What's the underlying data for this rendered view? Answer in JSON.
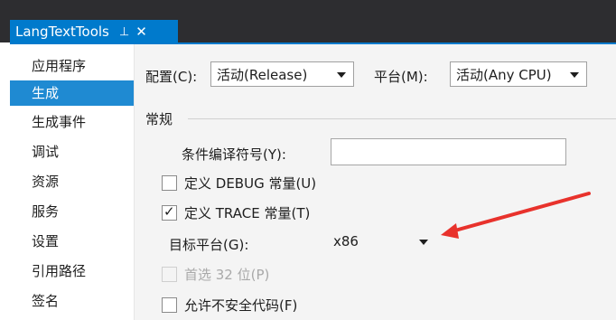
{
  "window": {
    "tab_title": "LangTextTools",
    "pin_icon": "pin-icon",
    "close_icon": "close-icon",
    "accent_color": "#007acc"
  },
  "nav": {
    "items": [
      {
        "label": "应用程序",
        "selected": false
      },
      {
        "label": "生成",
        "selected": true
      },
      {
        "label": "生成事件",
        "selected": false
      },
      {
        "label": "调试",
        "selected": false
      },
      {
        "label": "资源",
        "selected": false
      },
      {
        "label": "服务",
        "selected": false
      },
      {
        "label": "设置",
        "selected": false
      },
      {
        "label": "引用路径",
        "selected": false
      },
      {
        "label": "签名",
        "selected": false
      }
    ]
  },
  "config": {
    "config_label": "配置(C):",
    "config_value": "活动(Release)",
    "platform_label": "平台(M):",
    "platform_value": "活动(Any CPU)"
  },
  "general": {
    "section_title": "常规",
    "symbols_label": "条件编译符号(Y):",
    "symbols_value": "",
    "define_debug_label": "定义 DEBUG 常量(U)",
    "define_debug_checked": false,
    "define_trace_label": "定义 TRACE 常量(T)",
    "define_trace_checked": true,
    "check_glyph": "✓",
    "platform_target_label": "目标平台(G):",
    "platform_target_value": "x86",
    "prefer32_label": "首选 32 位(P)",
    "prefer32_checked": false,
    "prefer32_enabled": false,
    "unsafe_label": "允许不安全代码(F)",
    "unsafe_checked": false
  },
  "annotation": {
    "arrow_color": "#e8322c"
  }
}
